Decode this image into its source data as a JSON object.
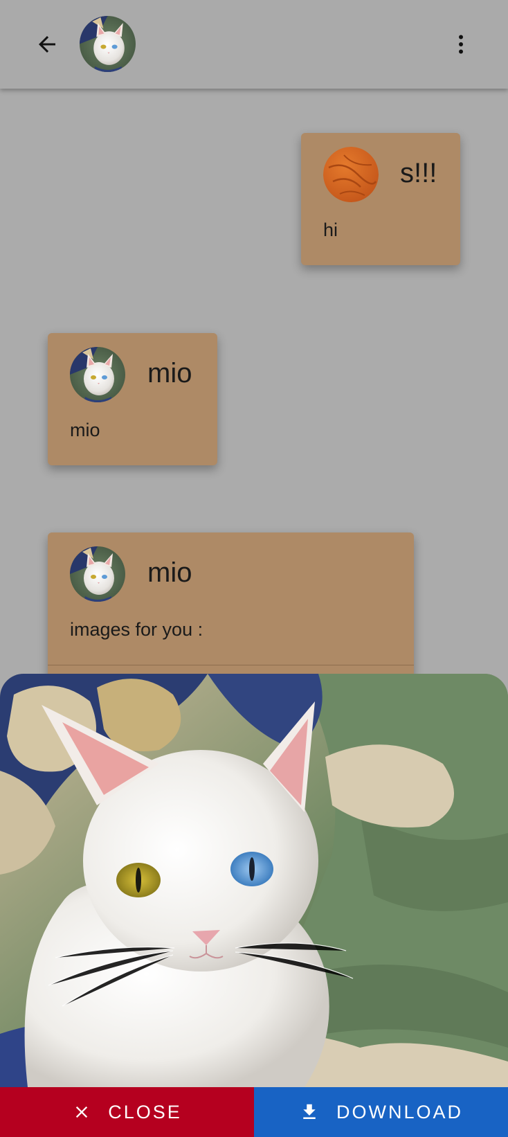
{
  "appbar": {
    "back_icon": "arrow-back-icon",
    "avatar_icon": "cat-avatar",
    "more_icon": "more-vert-icon"
  },
  "messages": [
    {
      "sender": "s!!!",
      "text": "hi",
      "avatar": "orange-ball-avatar"
    },
    {
      "sender": "mio",
      "text": "mio",
      "avatar": "cat-avatar"
    },
    {
      "sender": "mio",
      "text": "images for you :",
      "avatar": "cat-avatar"
    }
  ],
  "viewer": {
    "image": "white-cat-heterochromia-photo",
    "close_label": "CLOSE",
    "download_label": "DOWNLOAD",
    "close_icon": "close-icon",
    "download_icon": "download-icon"
  },
  "colors": {
    "card": "#ae8a66",
    "scrim": "#ababab",
    "close": "#b5001f",
    "download": "#1863c4"
  }
}
